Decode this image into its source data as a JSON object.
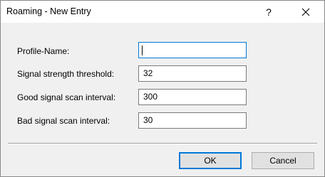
{
  "window": {
    "title": "Roaming - New Entry",
    "help_label": "?",
    "close_icon": "close-icon"
  },
  "form": {
    "profile_name": {
      "label": "Profile-Name:",
      "value": ""
    },
    "signal_threshold": {
      "label": "Signal strength threshold:",
      "value": "32"
    },
    "good_scan_interval": {
      "label": "Good signal scan interval:",
      "value": "300"
    },
    "bad_scan_interval": {
      "label": "Bad signal scan interval:",
      "value": "30"
    }
  },
  "buttons": {
    "ok_label": "OK",
    "cancel_label": "Cancel"
  },
  "colors": {
    "focus_border": "#0078d7",
    "dialog_background": "#f0f0f0",
    "titlebar_background": "#ffffff"
  }
}
